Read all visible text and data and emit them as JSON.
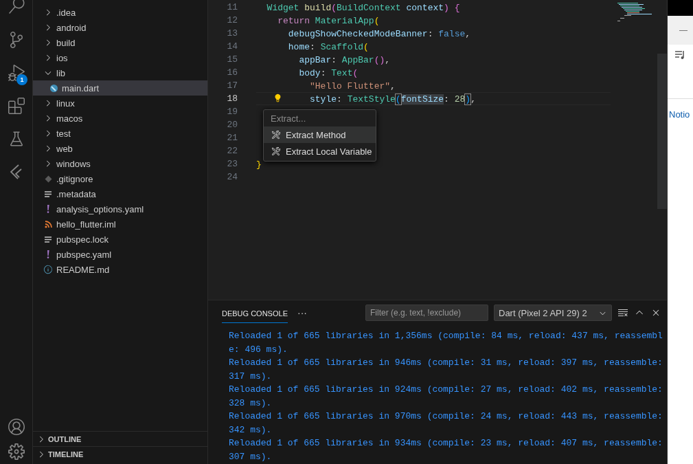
{
  "activity_bar": {
    "debug_badge": "1"
  },
  "explorer": {
    "items": [
      {
        "label": ".idea",
        "kind": "folder",
        "expanded": false,
        "selected": false
      },
      {
        "label": "android",
        "kind": "folder",
        "expanded": false,
        "selected": false
      },
      {
        "label": "build",
        "kind": "folder",
        "expanded": false,
        "selected": false
      },
      {
        "label": "ios",
        "kind": "folder",
        "expanded": false,
        "selected": false
      },
      {
        "label": "lib",
        "kind": "folder",
        "expanded": true,
        "selected": false,
        "children": [
          {
            "label": "main.dart",
            "kind": "dart",
            "selected": true
          }
        ]
      },
      {
        "label": "linux",
        "kind": "folder",
        "expanded": false,
        "selected": false
      },
      {
        "label": "macos",
        "kind": "folder",
        "expanded": false,
        "selected": false
      },
      {
        "label": "test",
        "kind": "folder",
        "expanded": false,
        "selected": false
      },
      {
        "label": "web",
        "kind": "folder",
        "expanded": false,
        "selected": false
      },
      {
        "label": "windows",
        "kind": "folder",
        "expanded": false,
        "selected": false
      },
      {
        "label": ".gitignore",
        "kind": "git",
        "selected": false
      },
      {
        "label": ".metadata",
        "kind": "lines",
        "selected": false
      },
      {
        "label": "analysis_options.yaml",
        "kind": "yaml",
        "selected": false
      },
      {
        "label": "hello_flutter.iml",
        "kind": "rss",
        "selected": false
      },
      {
        "label": "pubspec.lock",
        "kind": "lines",
        "selected": false
      },
      {
        "label": "pubspec.yaml",
        "kind": "yaml",
        "selected": false
      },
      {
        "label": "README.md",
        "kind": "info",
        "selected": false
      }
    ],
    "sections": [
      {
        "label": "OUTLINE",
        "expanded": false
      },
      {
        "label": "TIMELINE",
        "expanded": false
      }
    ]
  },
  "editor": {
    "lines": [
      {
        "number": "11",
        "current": false,
        "tokens": [
          {
            "text": "  Widget ",
            "kind": "type"
          },
          {
            "text": "build",
            "kind": "fn"
          },
          {
            "text": "(",
            "kind": "b2"
          },
          {
            "text": "BuildContext ",
            "kind": "type"
          },
          {
            "text": "context",
            "kind": "prop"
          },
          {
            "text": ") ",
            "kind": "b2"
          },
          {
            "text": "{",
            "kind": "b2"
          }
        ]
      },
      {
        "number": "12",
        "current": false,
        "tokens": [
          {
            "text": "    return ",
            "kind": "keyword"
          },
          {
            "text": "MaterialApp",
            "kind": "type"
          },
          {
            "text": "(",
            "kind": "b1"
          }
        ]
      },
      {
        "number": "13",
        "current": false,
        "tokens": [
          {
            "text": "      debugShowCheckedModeBanner",
            "kind": "prop"
          },
          {
            "text": ": ",
            "kind": "punct"
          },
          {
            "text": "false",
            "kind": "bool"
          },
          {
            "text": ",",
            "kind": "punct"
          }
        ]
      },
      {
        "number": "14",
        "current": false,
        "tokens": [
          {
            "text": "      home",
            "kind": "prop"
          },
          {
            "text": ": ",
            "kind": "punct"
          },
          {
            "text": "Scaffold",
            "kind": "type"
          },
          {
            "text": "(",
            "kind": "b1"
          }
        ]
      },
      {
        "number": "15",
        "current": false,
        "tokens": [
          {
            "text": "        appBar",
            "kind": "prop"
          },
          {
            "text": ": ",
            "kind": "punct"
          },
          {
            "text": "AppBar",
            "kind": "type"
          },
          {
            "text": "()",
            "kind": "b2"
          },
          {
            "text": ",",
            "kind": "punct"
          }
        ]
      },
      {
        "number": "16",
        "current": false,
        "tokens": [
          {
            "text": "        body",
            "kind": "prop"
          },
          {
            "text": ": ",
            "kind": "punct"
          },
          {
            "text": "Text",
            "kind": "type"
          },
          {
            "text": "(",
            "kind": "b2"
          }
        ]
      },
      {
        "number": "17",
        "current": false,
        "tokens": [
          {
            "text": "          \"Hello Flutter\"",
            "kind": "string"
          },
          {
            "text": ",",
            "kind": "punct"
          }
        ]
      },
      {
        "number": "18",
        "current": true,
        "tokens": [
          {
            "text": "          style",
            "kind": "prop"
          },
          {
            "text": ": ",
            "kind": "punct"
          },
          {
            "text": "TextStyle",
            "kind": "type"
          },
          {
            "text": "(",
            "kind": "match"
          },
          {
            "text": "fontSize",
            "kind": "selection"
          },
          {
            "text": ": ",
            "kind": "punct"
          },
          {
            "text": "28",
            "kind": "number"
          },
          {
            "text": ")",
            "kind": "match"
          },
          {
            "text": ",",
            "kind": "punct"
          }
        ]
      },
      {
        "number": "19",
        "current": false
      },
      {
        "number": "20",
        "current": false
      },
      {
        "number": "21",
        "current": false
      },
      {
        "number": "22",
        "current": false
      },
      {
        "number": "23",
        "current": false,
        "tokens": [
          {
            "text": "}",
            "kind": "b1"
          }
        ]
      },
      {
        "number": "24",
        "current": false
      }
    ],
    "context_menu": {
      "title": "Extract...",
      "items": [
        {
          "label": "Extract Method",
          "selected": true
        },
        {
          "label": "Extract Local Variable",
          "selected": false
        }
      ]
    }
  },
  "panel": {
    "tabs": [
      {
        "label": "DEBUG CONSOLE",
        "selected": true
      }
    ],
    "more": "···",
    "filter": {
      "placeholder": "Filter (e.g. text, !exclude)"
    },
    "session": "Dart (Pixel 2 API 29) 2",
    "lines": [
      "Reloaded 1 of 665 libraries in 1,356ms (compile: 84 ms, reload: 437 ms, reassemble: 496 ms).",
      "Reloaded 1 of 665 libraries in 946ms (compile: 31 ms, reload: 397 ms, reassemble: 317 ms).",
      "Reloaded 1 of 665 libraries in 924ms (compile: 27 ms, reload: 402 ms, reassemble: 328 ms).",
      "Reloaded 1 of 665 libraries in 970ms (compile: 24 ms, reload: 443 ms, reassemble: 342 ms).",
      "Reloaded 1 of 665 libraries in 934ms (compile: 23 ms, reload: 407 ms, reassemble: 307 ms)."
    ]
  },
  "side_window": {
    "label": "Notio"
  }
}
